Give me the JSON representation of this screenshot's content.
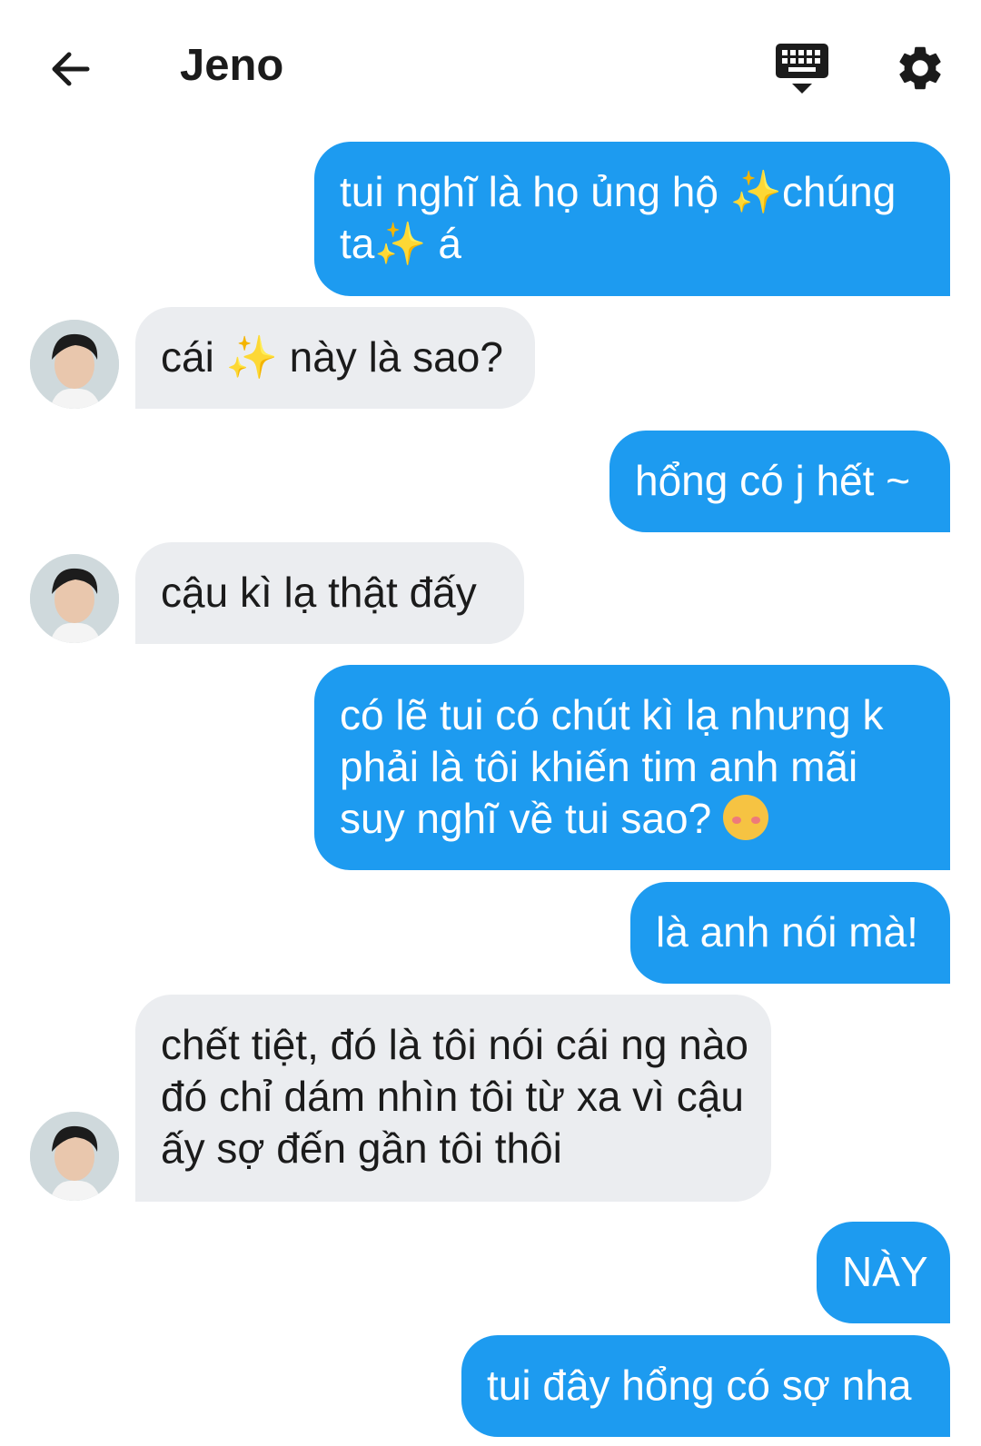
{
  "header": {
    "title": "Jeno",
    "back_icon": "arrow-left-icon",
    "keyboard_icon": "keyboard-icon",
    "settings_icon": "gear-icon"
  },
  "colors": {
    "outgoing_bubble": "#1d9bf0",
    "incoming_bubble": "#ebedf0"
  },
  "messages": [
    {
      "direction": "out",
      "text": "tui nghĩ là họ ủng hộ ✨chúng ta✨ á"
    },
    {
      "direction": "in",
      "text": "cái ✨ này là sao?"
    },
    {
      "direction": "out",
      "text": "hổng có j hết ~"
    },
    {
      "direction": "in",
      "text": "cậu kì lạ thật đấy"
    },
    {
      "direction": "out",
      "text": "có lẽ tui có chút kì lạ nhưng k phải là tôi khiến tim anh mãi suy nghĩ về tui sao?",
      "emoji": "woozy-face"
    },
    {
      "direction": "out",
      "text": "là anh nói mà!"
    },
    {
      "direction": "in",
      "text": "chết tiệt, đó là tôi nói cái ng nào đó chỉ dám nhìn tôi từ xa vì cậu ấy sợ đến gần tôi thôi"
    },
    {
      "direction": "out",
      "text": "NÀY"
    },
    {
      "direction": "out",
      "text": "tui đây hổng có sợ nha"
    }
  ]
}
